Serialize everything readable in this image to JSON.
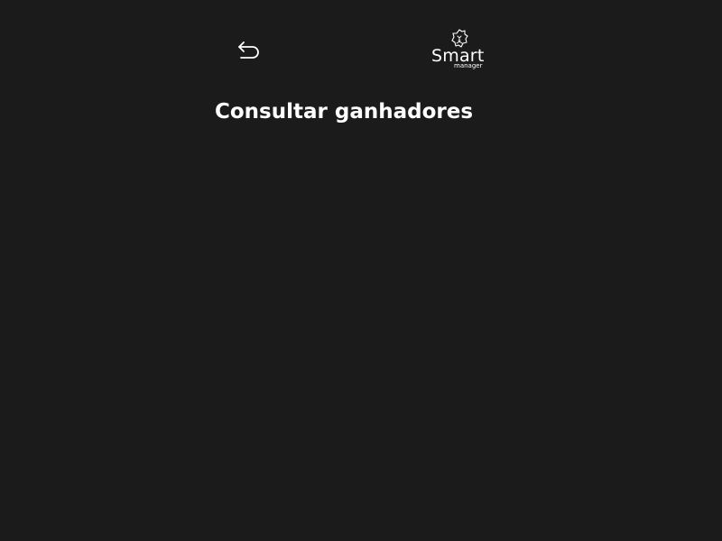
{
  "header": {
    "back_icon": "back-arrow-icon",
    "logo": {
      "wordmark": "Smart",
      "subtitle": "manager",
      "mark_icon": "lion-head-icon"
    }
  },
  "main": {
    "title": "Consultar ganhadores"
  },
  "colors": {
    "background": "#1b1b1b",
    "text": "#ffffff"
  }
}
